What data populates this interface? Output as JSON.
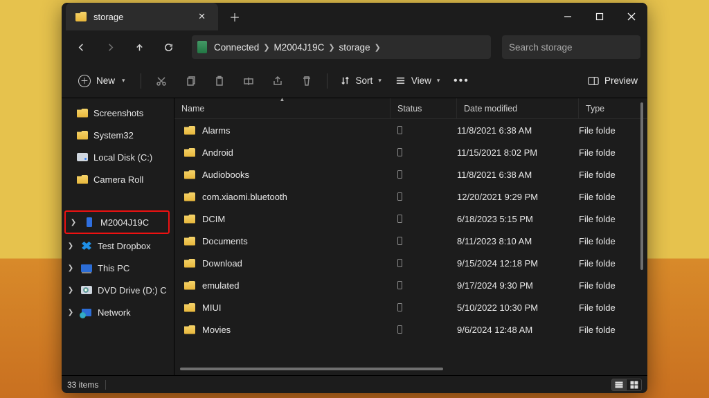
{
  "window": {
    "tab_title": "storage"
  },
  "breadcrumb": {
    "segments": [
      "Connected",
      "M2004J19C",
      "storage"
    ]
  },
  "search": {
    "placeholder": "Search storage"
  },
  "toolbar": {
    "new_label": "New",
    "sort_label": "Sort",
    "view_label": "View",
    "preview_label": "Preview"
  },
  "columns": {
    "name": "Name",
    "status": "Status",
    "date": "Date modified",
    "type": "Type"
  },
  "sidebar": {
    "quick": [
      {
        "label": "Screenshots",
        "icon": "folder"
      },
      {
        "label": "System32",
        "icon": "folder"
      },
      {
        "label": "Local Disk (C:)",
        "icon": "drive"
      },
      {
        "label": "Camera Roll",
        "icon": "folder"
      }
    ],
    "devices": [
      {
        "label": "M2004J19C",
        "icon": "phone",
        "highlight": true
      },
      {
        "label": "Test Dropbox",
        "icon": "dropbox"
      },
      {
        "label": "This PC",
        "icon": "pc"
      },
      {
        "label": "DVD Drive (D:) C",
        "icon": "dvd"
      },
      {
        "label": "Network",
        "icon": "net"
      }
    ]
  },
  "files": [
    {
      "name": "Alarms",
      "date": "11/8/2021 6:38 AM",
      "type": "File folde"
    },
    {
      "name": "Android",
      "date": "11/15/2021 8:02 PM",
      "type": "File folde"
    },
    {
      "name": "Audiobooks",
      "date": "11/8/2021 6:38 AM",
      "type": "File folde"
    },
    {
      "name": "com.xiaomi.bluetooth",
      "date": "12/20/2021 9:29 PM",
      "type": "File folde"
    },
    {
      "name": "DCIM",
      "date": "6/18/2023 5:15 PM",
      "type": "File folde"
    },
    {
      "name": "Documents",
      "date": "8/11/2023 8:10 AM",
      "type": "File folde"
    },
    {
      "name": "Download",
      "date": "9/15/2024 12:18 PM",
      "type": "File folde"
    },
    {
      "name": "emulated",
      "date": "9/17/2024 9:30 PM",
      "type": "File folde"
    },
    {
      "name": "MIUI",
      "date": "5/10/2022 10:30 PM",
      "type": "File folde"
    },
    {
      "name": "Movies",
      "date": "9/6/2024 12:48 AM",
      "type": "File folde"
    }
  ],
  "status": {
    "items": "33 items"
  }
}
